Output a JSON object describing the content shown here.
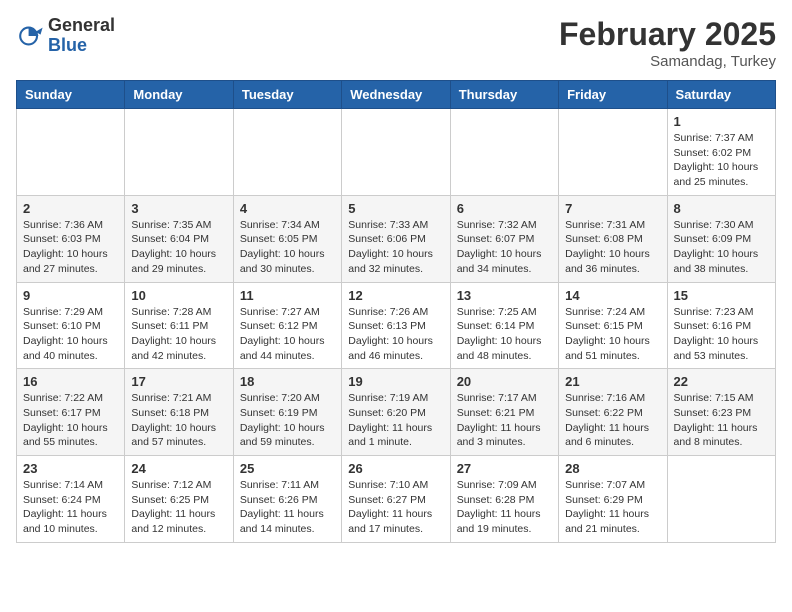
{
  "logo": {
    "general": "General",
    "blue": "Blue"
  },
  "title": {
    "month": "February 2025",
    "location": "Samandag, Turkey"
  },
  "weekdays": [
    "Sunday",
    "Monday",
    "Tuesday",
    "Wednesday",
    "Thursday",
    "Friday",
    "Saturday"
  ],
  "weeks": [
    [
      {
        "day": "",
        "info": ""
      },
      {
        "day": "",
        "info": ""
      },
      {
        "day": "",
        "info": ""
      },
      {
        "day": "",
        "info": ""
      },
      {
        "day": "",
        "info": ""
      },
      {
        "day": "",
        "info": ""
      },
      {
        "day": "1",
        "info": "Sunrise: 7:37 AM\nSunset: 6:02 PM\nDaylight: 10 hours and 25 minutes."
      }
    ],
    [
      {
        "day": "2",
        "info": "Sunrise: 7:36 AM\nSunset: 6:03 PM\nDaylight: 10 hours and 27 minutes."
      },
      {
        "day": "3",
        "info": "Sunrise: 7:35 AM\nSunset: 6:04 PM\nDaylight: 10 hours and 29 minutes."
      },
      {
        "day": "4",
        "info": "Sunrise: 7:34 AM\nSunset: 6:05 PM\nDaylight: 10 hours and 30 minutes."
      },
      {
        "day": "5",
        "info": "Sunrise: 7:33 AM\nSunset: 6:06 PM\nDaylight: 10 hours and 32 minutes."
      },
      {
        "day": "6",
        "info": "Sunrise: 7:32 AM\nSunset: 6:07 PM\nDaylight: 10 hours and 34 minutes."
      },
      {
        "day": "7",
        "info": "Sunrise: 7:31 AM\nSunset: 6:08 PM\nDaylight: 10 hours and 36 minutes."
      },
      {
        "day": "8",
        "info": "Sunrise: 7:30 AM\nSunset: 6:09 PM\nDaylight: 10 hours and 38 minutes."
      }
    ],
    [
      {
        "day": "9",
        "info": "Sunrise: 7:29 AM\nSunset: 6:10 PM\nDaylight: 10 hours and 40 minutes."
      },
      {
        "day": "10",
        "info": "Sunrise: 7:28 AM\nSunset: 6:11 PM\nDaylight: 10 hours and 42 minutes."
      },
      {
        "day": "11",
        "info": "Sunrise: 7:27 AM\nSunset: 6:12 PM\nDaylight: 10 hours and 44 minutes."
      },
      {
        "day": "12",
        "info": "Sunrise: 7:26 AM\nSunset: 6:13 PM\nDaylight: 10 hours and 46 minutes."
      },
      {
        "day": "13",
        "info": "Sunrise: 7:25 AM\nSunset: 6:14 PM\nDaylight: 10 hours and 48 minutes."
      },
      {
        "day": "14",
        "info": "Sunrise: 7:24 AM\nSunset: 6:15 PM\nDaylight: 10 hours and 51 minutes."
      },
      {
        "day": "15",
        "info": "Sunrise: 7:23 AM\nSunset: 6:16 PM\nDaylight: 10 hours and 53 minutes."
      }
    ],
    [
      {
        "day": "16",
        "info": "Sunrise: 7:22 AM\nSunset: 6:17 PM\nDaylight: 10 hours and 55 minutes."
      },
      {
        "day": "17",
        "info": "Sunrise: 7:21 AM\nSunset: 6:18 PM\nDaylight: 10 hours and 57 minutes."
      },
      {
        "day": "18",
        "info": "Sunrise: 7:20 AM\nSunset: 6:19 PM\nDaylight: 10 hours and 59 minutes."
      },
      {
        "day": "19",
        "info": "Sunrise: 7:19 AM\nSunset: 6:20 PM\nDaylight: 11 hours and 1 minute."
      },
      {
        "day": "20",
        "info": "Sunrise: 7:17 AM\nSunset: 6:21 PM\nDaylight: 11 hours and 3 minutes."
      },
      {
        "day": "21",
        "info": "Sunrise: 7:16 AM\nSunset: 6:22 PM\nDaylight: 11 hours and 6 minutes."
      },
      {
        "day": "22",
        "info": "Sunrise: 7:15 AM\nSunset: 6:23 PM\nDaylight: 11 hours and 8 minutes."
      }
    ],
    [
      {
        "day": "23",
        "info": "Sunrise: 7:14 AM\nSunset: 6:24 PM\nDaylight: 11 hours and 10 minutes."
      },
      {
        "day": "24",
        "info": "Sunrise: 7:12 AM\nSunset: 6:25 PM\nDaylight: 11 hours and 12 minutes."
      },
      {
        "day": "25",
        "info": "Sunrise: 7:11 AM\nSunset: 6:26 PM\nDaylight: 11 hours and 14 minutes."
      },
      {
        "day": "26",
        "info": "Sunrise: 7:10 AM\nSunset: 6:27 PM\nDaylight: 11 hours and 17 minutes."
      },
      {
        "day": "27",
        "info": "Sunrise: 7:09 AM\nSunset: 6:28 PM\nDaylight: 11 hours and 19 minutes."
      },
      {
        "day": "28",
        "info": "Sunrise: 7:07 AM\nSunset: 6:29 PM\nDaylight: 11 hours and 21 minutes."
      },
      {
        "day": "",
        "info": ""
      }
    ]
  ]
}
